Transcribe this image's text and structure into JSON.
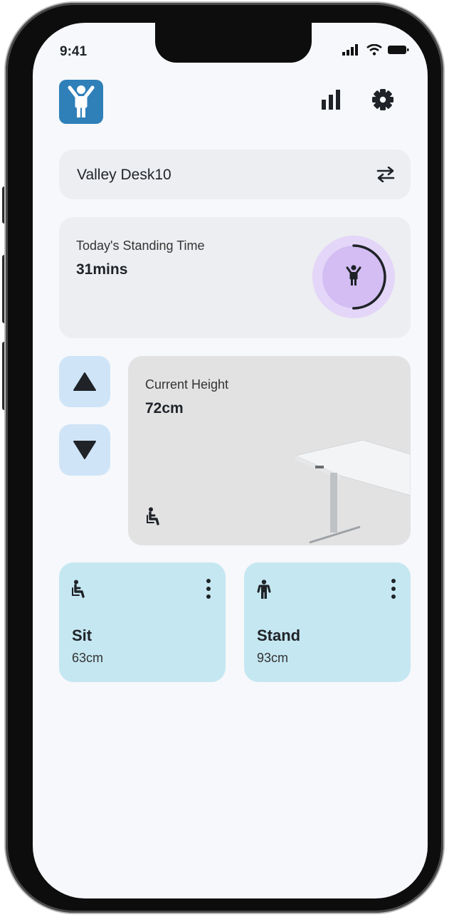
{
  "status_bar": {
    "time": "9:41"
  },
  "header": {
    "logo_icon": "standing-person-icon",
    "stats_icon": "bar-chart-icon",
    "settings_icon": "gear-icon"
  },
  "desk_selector": {
    "name": "Valley Desk10",
    "switch_icon": "swap-arrows-icon"
  },
  "standing_time": {
    "label": "Today's Standing Time",
    "value": "31mins",
    "progress": 0.5
  },
  "height_controls": {
    "up_icon": "triangle-up-icon",
    "down_icon": "triangle-down-icon"
  },
  "current_height": {
    "label": "Current Height",
    "value": "72cm",
    "mode_icon": "seated-person-icon"
  },
  "presets": [
    {
      "name": "Sit",
      "value": "63cm",
      "icon": "seated-person-icon"
    },
    {
      "name": "Stand",
      "value": "93cm",
      "icon": "standing-person-icon"
    }
  ],
  "colors": {
    "accent_blue": "#2f80b8",
    "preset_bg": "#c5e7f1",
    "ring_bg": "#d9c6f5",
    "arrow_btn_bg": "#cfe4f7"
  }
}
